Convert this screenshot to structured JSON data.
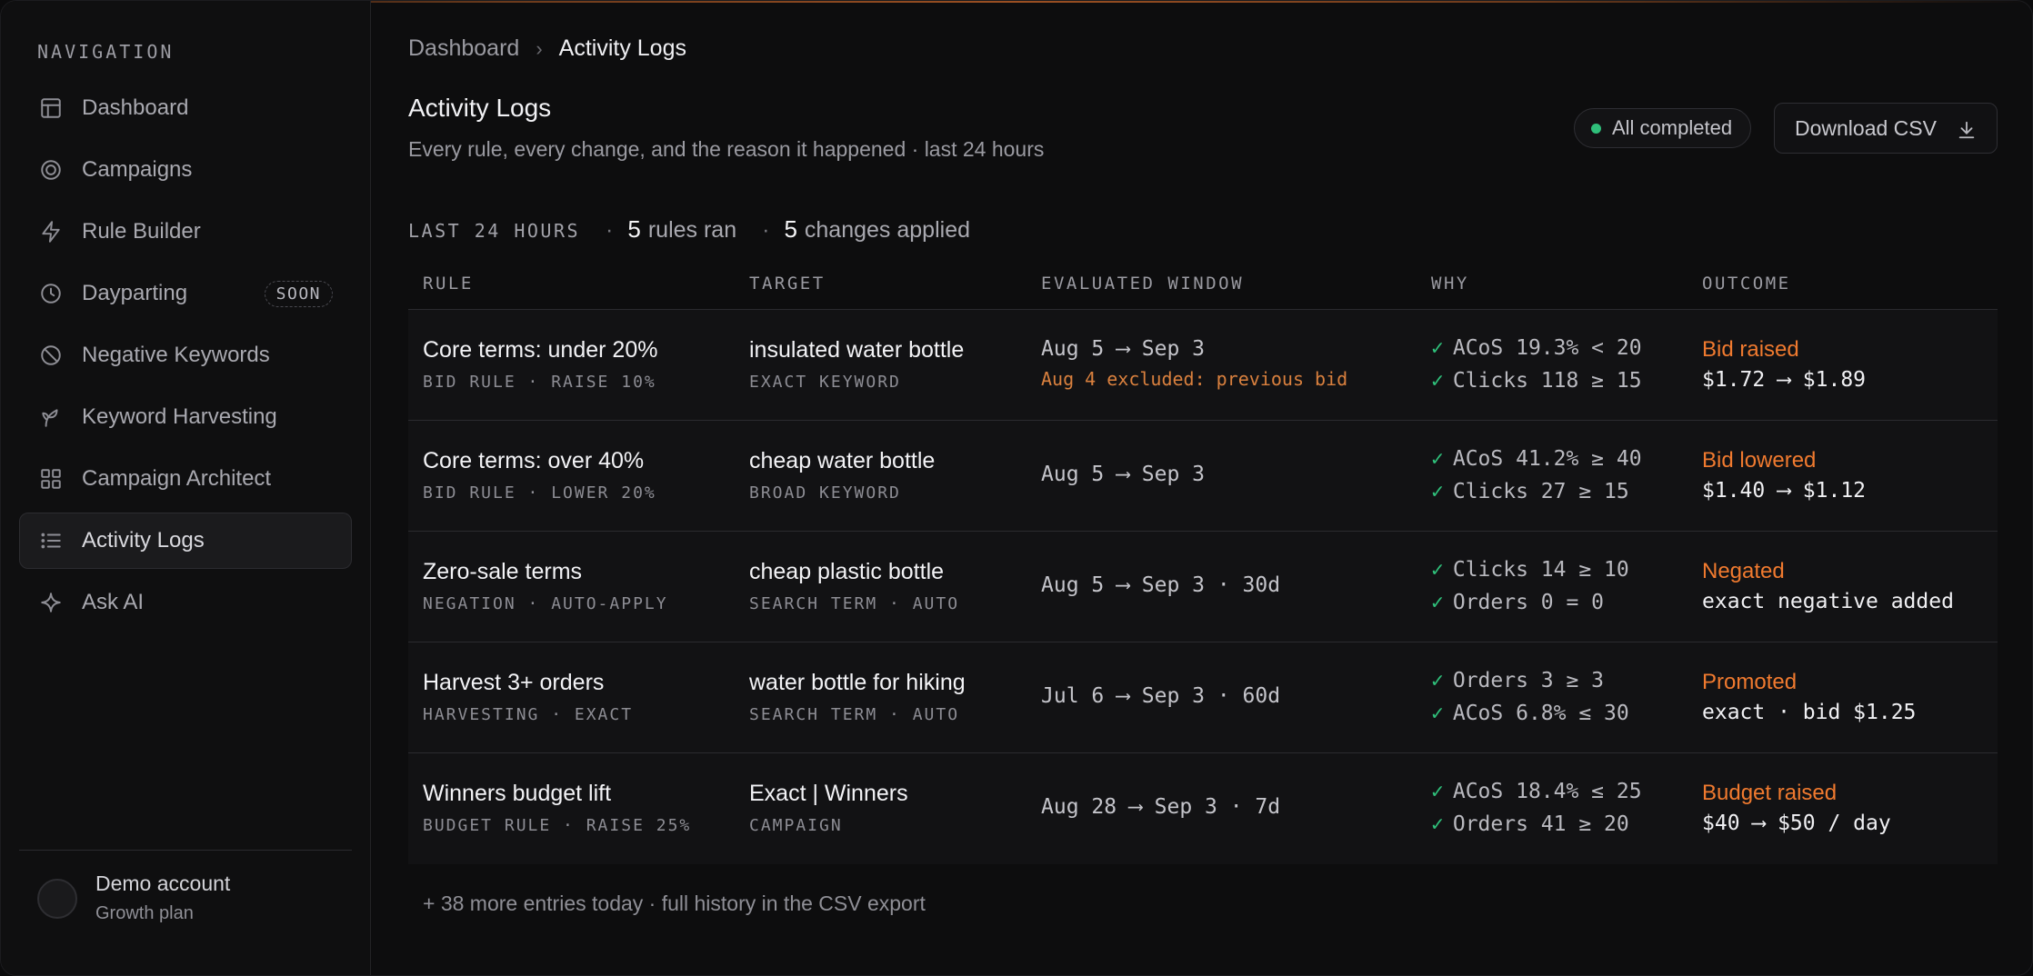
{
  "sidebar": {
    "heading": "NAVIGATION",
    "items": [
      {
        "label": "Dashboard",
        "icon": "layout-icon"
      },
      {
        "label": "Campaigns",
        "icon": "target-icon"
      },
      {
        "label": "Rule Builder",
        "icon": "bolt-icon"
      },
      {
        "label": "Dayparting",
        "icon": "clock-icon",
        "badge": "SOON"
      },
      {
        "label": "Negative Keywords",
        "icon": "ban-icon"
      },
      {
        "label": "Keyword Harvesting",
        "icon": "sprout-icon"
      },
      {
        "label": "Campaign Architect",
        "icon": "grid-icon"
      },
      {
        "label": "Activity Logs",
        "icon": "list-icon",
        "active": true
      },
      {
        "label": "Ask AI",
        "icon": "sparkle-icon"
      }
    ],
    "account": {
      "name": "Demo account",
      "plan": "Growth plan"
    }
  },
  "breadcrumb": {
    "parent": "Dashboard",
    "separator": "›",
    "current": "Activity Logs"
  },
  "header": {
    "title": "Activity Logs",
    "subtitle": "Every rule, every change, and the reason it happened · last 24 hours",
    "status": "All completed",
    "download_label": "Download CSV"
  },
  "summary": {
    "period": "LAST 24 HOURS",
    "rules_count": "5",
    "rules_label": "rules ran",
    "changes_count": "5",
    "changes_label": "changes applied"
  },
  "table": {
    "columns": [
      "RULE",
      "TARGET",
      "EVALUATED WINDOW",
      "WHY",
      "OUTCOME"
    ],
    "rows": [
      {
        "rule": "Core terms: under 20%",
        "rule_meta": "BID RULE · RAISE 10%",
        "target": "insulated water bottle",
        "target_meta": "EXACT KEYWORD",
        "window": "Aug 5 ⟶ Sep 3",
        "window_note": "Aug 4 excluded: previous bid",
        "why": [
          "ACoS 19.3% < 20",
          "Clicks 118 ≥ 15"
        ],
        "outcome": "Bid raised",
        "outcome_detail": "$1.72 ⟶ $1.89"
      },
      {
        "rule": "Core terms: over 40%",
        "rule_meta": "BID RULE · LOWER 20%",
        "target": "cheap water bottle",
        "target_meta": "BROAD KEYWORD",
        "window": "Aug 5 ⟶ Sep 3",
        "window_note": "",
        "why": [
          "ACoS 41.2% ≥ 40",
          "Clicks 27 ≥ 15"
        ],
        "outcome": "Bid lowered",
        "outcome_detail": "$1.40 ⟶ $1.12"
      },
      {
        "rule": "Zero-sale terms",
        "rule_meta": "NEGATION · AUTO-APPLY",
        "target": "cheap plastic bottle",
        "target_meta": "SEARCH TERM · AUTO",
        "window": "Aug 5 ⟶ Sep 3 · 30d",
        "window_note": "",
        "why": [
          "Clicks 14 ≥ 10",
          "Orders 0 = 0"
        ],
        "outcome": "Negated",
        "outcome_detail": "exact negative added"
      },
      {
        "rule": "Harvest 3+ orders",
        "rule_meta": "HARVESTING · EXACT",
        "target": "water bottle for hiking",
        "target_meta": "SEARCH TERM · AUTO",
        "window": "Jul 6 ⟶ Sep 3 · 60d",
        "window_note": "",
        "why": [
          "Orders 3 ≥ 3",
          "ACoS 6.8% ≤ 30"
        ],
        "outcome": "Promoted",
        "outcome_detail": "exact · bid $1.25"
      },
      {
        "rule": "Winners budget lift",
        "rule_meta": "BUDGET RULE · RAISE 25%",
        "target": "Exact | Winners",
        "target_meta": "CAMPAIGN",
        "window": "Aug 28 ⟶ Sep 3 · 7d",
        "window_note": "",
        "why": [
          "ACoS 18.4% ≤ 25",
          "Orders 41 ≥ 20"
        ],
        "outcome": "Budget raised",
        "outcome_detail": "$40 ⟶ $50 / day"
      }
    ],
    "footer": "+ 38 more entries today · full history in the CSV export"
  },
  "colors": {
    "accent": "#f07a2f",
    "success": "#2fbf7a",
    "background": "#0d0d0e"
  }
}
